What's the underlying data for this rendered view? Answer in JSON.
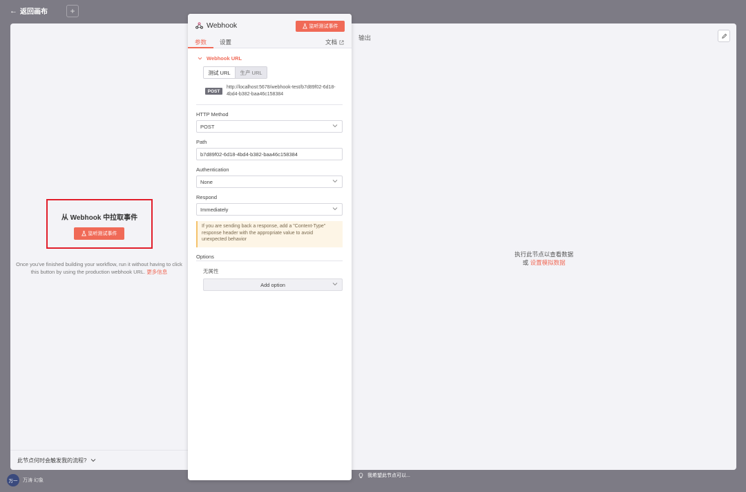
{
  "topbar": {
    "back_label": "返回画布"
  },
  "input_panel": {
    "title": "从 Webhook 中拉取事件",
    "listen_button": "监听测试事件",
    "help_text": "Once you've finished building your workflow, run it without having to click this button by using the production webhook URL.",
    "more_info": "更多信息",
    "trigger_question": "此节点何时会触发我的流程?"
  },
  "node": {
    "title": "Webhook",
    "listen_button": "监听测试事件",
    "tabs": {
      "params": "参数",
      "settings": "设置",
      "docs": "文档"
    },
    "webhook_url": {
      "heading": "Webhook URL",
      "test_url_tab": "测试 URL",
      "prod_url_tab": "生产 URL",
      "method_badge": "POST",
      "url": "http://localhost:5678/webhook-test/b7d89f02-6d18-4bd4-b382-baa46c158384"
    },
    "fields": {
      "http_method_label": "HTTP Method",
      "http_method_value": "POST",
      "path_label": "Path",
      "path_value": "b7d89f02-6d18-4bd4-b382-baa46c158384",
      "auth_label": "Authentication",
      "auth_value": "None",
      "respond_label": "Respond",
      "respond_value": "Immediately"
    },
    "notice": "If you are sending back a response, add a \"Content-Type\" response header with the appropriate value to avoid unexpected behavior",
    "options_label": "Options",
    "no_properties": "无属性",
    "add_option": "Add option"
  },
  "output_panel": {
    "title": "输出",
    "hint_line1": "执行此节点以查看数据",
    "hint_or": "或",
    "hint_link": "设置模拟数据"
  },
  "feedback": {
    "label": "我希望此节点可以..."
  },
  "user": {
    "avatar_text": "万一",
    "name": "万涛 幻象"
  },
  "colors": {
    "accent": "#f06a57",
    "highlight": "#e11d2a"
  }
}
